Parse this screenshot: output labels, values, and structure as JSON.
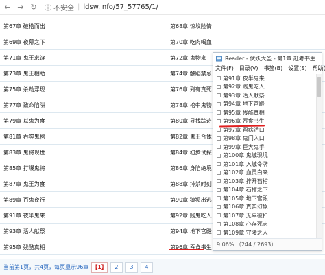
{
  "browser": {
    "back_icon": "←",
    "forward_icon": "→",
    "reload_icon": "↻",
    "warn_icon": "ⓘ",
    "insecure_label": "不安全",
    "separator": "|",
    "url": "ldsw.info/57_57765/1/"
  },
  "chapters": {
    "left": [
      "第67章 破楷而出",
      "第69章 夜幕之下",
      "第71章 鬼王求饶",
      "第73章 鬼王相助",
      "第75章 杀劫浮现",
      "第77章 致命陷阱",
      "第79章 以鬼为食",
      "第81章 吞噬鬼物",
      "第83章 鬼将现世",
      "第85章 打爆鬼将",
      "第87章 鬼王为食",
      "第89章 百鬼夜行",
      "第91章 夜半鬼来",
      "第93章 活人献祭",
      "第95章 残酷真相"
    ],
    "right": [
      "第68章 惊坟险情",
      "第70章 吃肉喝血",
      "第72章 鬼物来",
      "第74章 触蹈禁忌",
      "第76章 到有真死",
      "第78章 棺中鬼物",
      "第80章 寻找踪迹",
      "第82章 鬼王合体",
      "第84章 初步试探",
      "第86章 身陷绝境",
      "第88章 排杀时刻",
      "第90章 猿狈出逃",
      "第92章 贱鬼吃人",
      "第94章 地下宫殿",
      "第96章 吞食书生"
    ]
  },
  "pager": {
    "info": "当前第1页，共4页，每页显示96章",
    "pages": [
      "【1】",
      "2",
      "3",
      "4"
    ]
  },
  "reader": {
    "title": "Reader - 伏妖大圣 - 第1章 赶考书生",
    "menu": [
      "文件(F)",
      "目录(V)",
      "书签(B)",
      "设置(S)",
      "帮助(H)"
    ],
    "toc": [
      "第91章 夜半鬼来",
      "第92章 贱鬼吃人",
      "第93章 活人献祭",
      "第94章 地下宫殿",
      "第95章 残酷真相",
      "第96章 吞食书生",
      "第97章 留病活口",
      "第98章 鬼门入口",
      "第99章 巨大鬼手",
      "第100章 鬼城现境",
      "第101章 入城令牌",
      "第102章 血灵白来",
      "第103章 排开石棺",
      "第104章 石棺之下",
      "第105章 地下宫殿",
      "第106章 真实幻象",
      "第107章 无辜被扣",
      "第108章 心存死志",
      "第109章 守陵之人"
    ],
    "status": "9.06% （244 / 2693）"
  },
  "colors": {
    "link_blue": "#2a6ac0",
    "highlight_red": "#e02020",
    "row_border": "#dde8f0"
  }
}
